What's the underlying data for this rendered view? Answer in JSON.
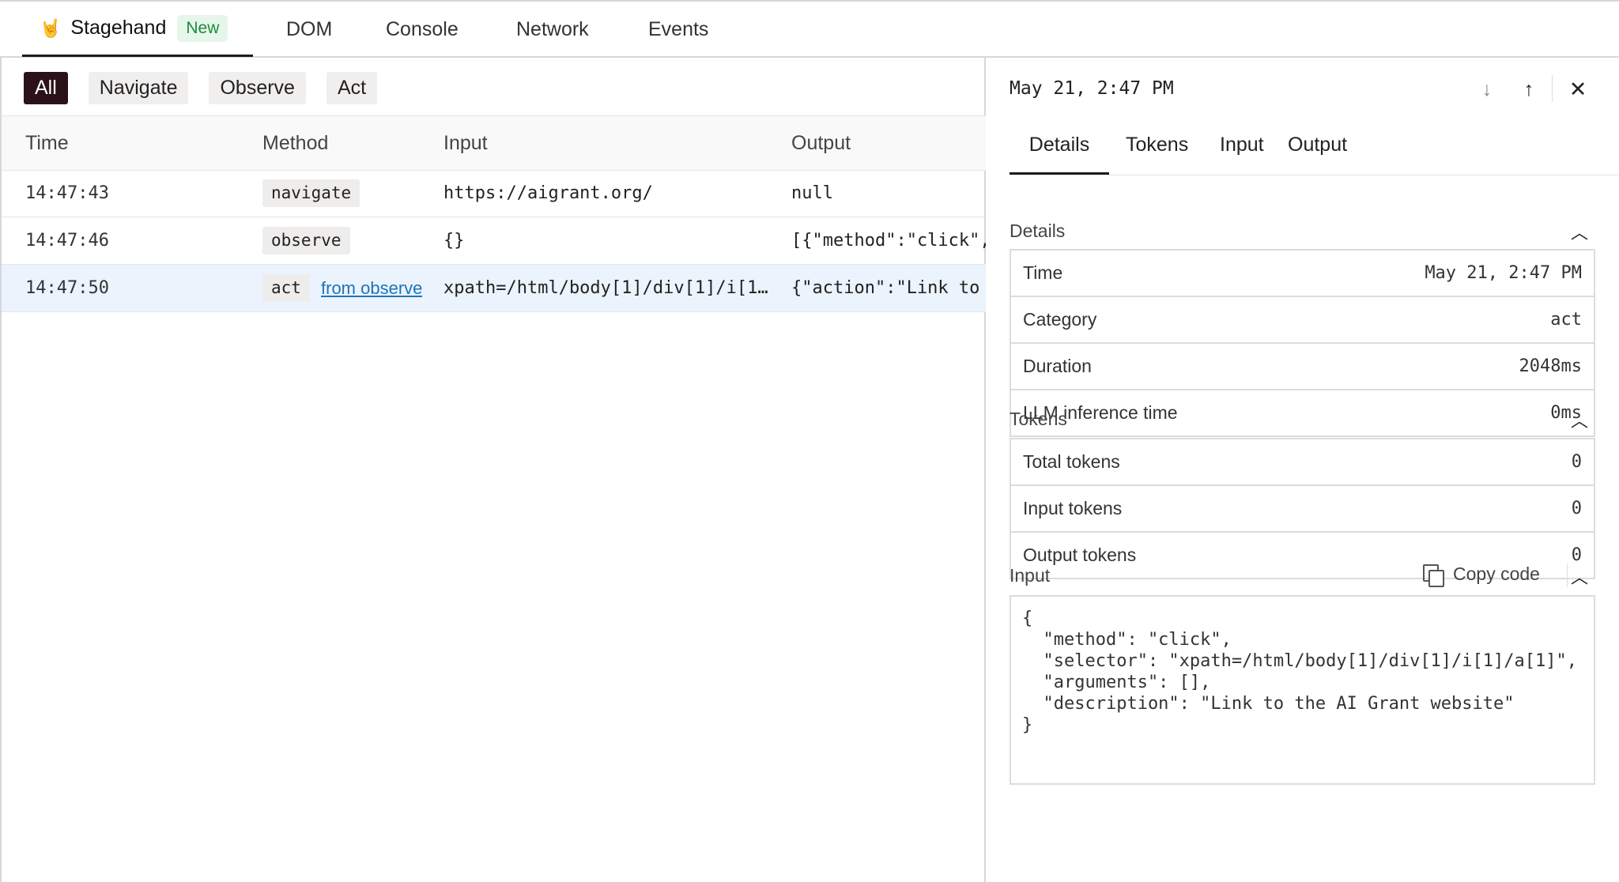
{
  "top_tabs": {
    "stagehand": "Stagehand",
    "stagehand_icon": "🤘",
    "new_badge": "New",
    "dom": "DOM",
    "console": "Console",
    "network": "Network",
    "events": "Events"
  },
  "filters": [
    "All",
    "Navigate",
    "Observe",
    "Act"
  ],
  "table": {
    "headers": {
      "time": "Time",
      "method": "Method",
      "input": "Input",
      "output": "Output"
    },
    "rows": [
      {
        "time": "14:47:43",
        "method": "navigate",
        "link": "",
        "input": "https://aigrant.org/",
        "output": "null"
      },
      {
        "time": "14:47:46",
        "method": "observe",
        "link": "",
        "input": "{}",
        "output": "[{\"method\":\"click\","
      },
      {
        "time": "14:47:50",
        "method": "act",
        "link": "from observe",
        "input": "xpath=/html/body[1]/div[1]/i[1]…",
        "output": "{\"action\":\"Link to"
      }
    ]
  },
  "detail": {
    "timestamp": "May 21, 2:47 PM",
    "tabs": [
      "Details",
      "Tokens",
      "Input",
      "Output"
    ],
    "details_section": {
      "title": "Details",
      "rows": [
        {
          "key": "Time",
          "value": "May 21, 2:47 PM"
        },
        {
          "key": "Category",
          "value": "act"
        },
        {
          "key": "Duration",
          "value": "2048ms"
        },
        {
          "key": "LLM inference time",
          "value": "0ms"
        }
      ]
    },
    "tokens_section": {
      "title": "Tokens",
      "rows": [
        {
          "key": "Total tokens",
          "value": "0"
        },
        {
          "key": "Input tokens",
          "value": "0"
        },
        {
          "key": "Output tokens",
          "value": "0"
        }
      ]
    },
    "input_section": {
      "title": "Input",
      "copy_label": "Copy code",
      "code": "{\n  \"method\": \"click\",\n  \"selector\": \"xpath=/html/body[1]/div[1]/i[1]/a[1]\",\n  \"arguments\": [],\n  \"description\": \"Link to the AI Grant website\"\n}"
    }
  },
  "colors": {
    "active_filter_bg": "#2b1219",
    "selected_row_bg": "#ebf3fd",
    "link": "#1e74b8",
    "new_badge": "#1f8a3d"
  },
  "icons": {
    "arrow_down": "arrow-down-icon",
    "arrow_up": "arrow-up-icon",
    "close": "close-icon",
    "chevron_up": "chevron-up-icon",
    "copy": "copy-icon"
  }
}
